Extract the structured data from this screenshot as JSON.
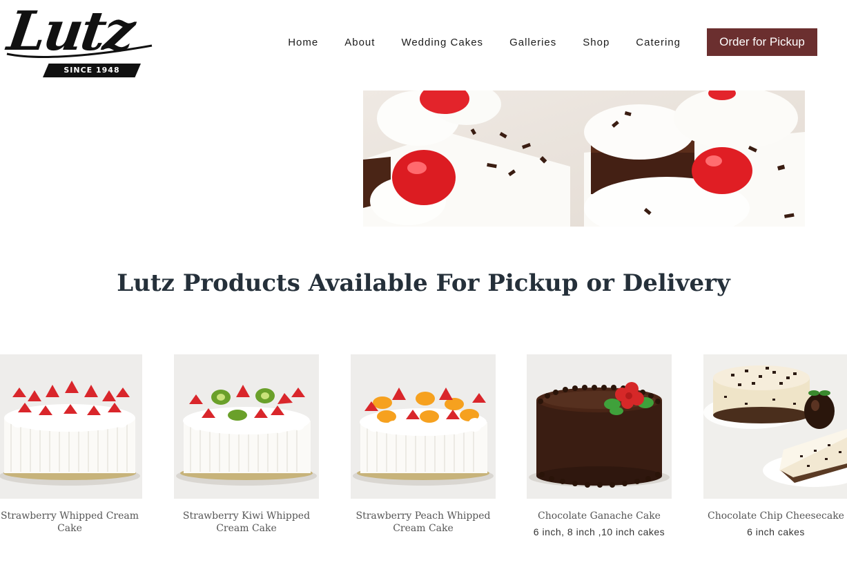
{
  "logo": {
    "wordmark": "Lutz",
    "since": "SINCE 1948"
  },
  "nav": {
    "links": [
      "Home",
      "About",
      "Wedding Cakes",
      "Galleries",
      "Shop",
      "Catering"
    ],
    "cta": "Order for Pickup"
  },
  "section": {
    "title_bold": "Lutz Products",
    "title_rest": " Available For Pickup or Delivery"
  },
  "products": [
    {
      "name": "Strawberry Whipped Cream Cake",
      "sizes": ""
    },
    {
      "name": "Strawberry Kiwi Whipped Cream Cake",
      "sizes": ""
    },
    {
      "name": "Strawberry Peach Whipped Cream Cake",
      "sizes": ""
    },
    {
      "name": "Chocolate Ganache Cake",
      "sizes": "6 inch, 8 inch ,10 inch cakes"
    },
    {
      "name": "Chocolate Chip Cheesecake",
      "sizes": "6 inch cakes"
    }
  ],
  "colors": {
    "accent": "#6b2f2f",
    "heading": "#25303a",
    "cherry": "#e3242b",
    "cream": "#fbfaf7",
    "chocolate": "#3a1d12"
  }
}
